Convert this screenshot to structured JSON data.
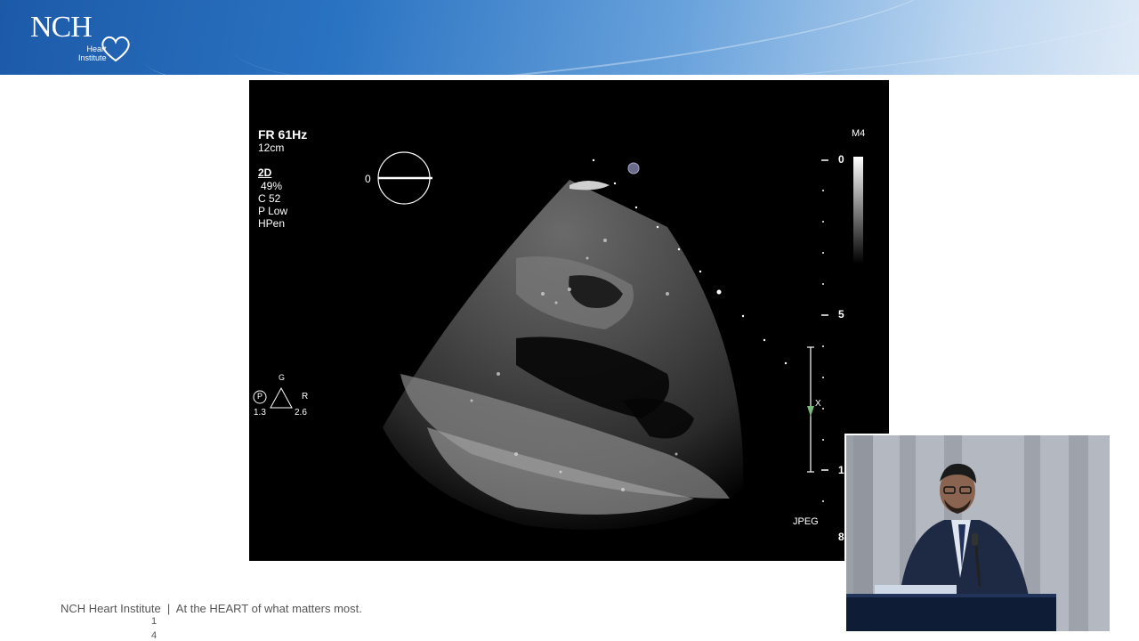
{
  "banner": {
    "logo_text": "NCH",
    "logo_sub_1": "Heart",
    "logo_sub_2": "Institute"
  },
  "echo": {
    "fr": "FR 61Hz",
    "depth": "12cm",
    "mode": "2D",
    "gain": "49%",
    "c": "C 52",
    "p": "P Low",
    "hpen": "HPen",
    "angle": "0",
    "probe": "M4",
    "scale_0": "0",
    "scale_5": "5",
    "scale_1": "1",
    "scale_8": "8",
    "orient_top": "G",
    "orient_p": "P",
    "orient_r": "R",
    "orient_left": "1.3",
    "orient_right": "2.6",
    "format": "JPEG",
    "marker_x": "X"
  },
  "footer": {
    "tagline": "NCH Heart Institute  |  At the HEART of what matters most.",
    "page_line1": "1",
    "page_line2": "4"
  },
  "colors": {
    "banner_blue": "#1c5aa8",
    "echo_bg": "#000000"
  }
}
